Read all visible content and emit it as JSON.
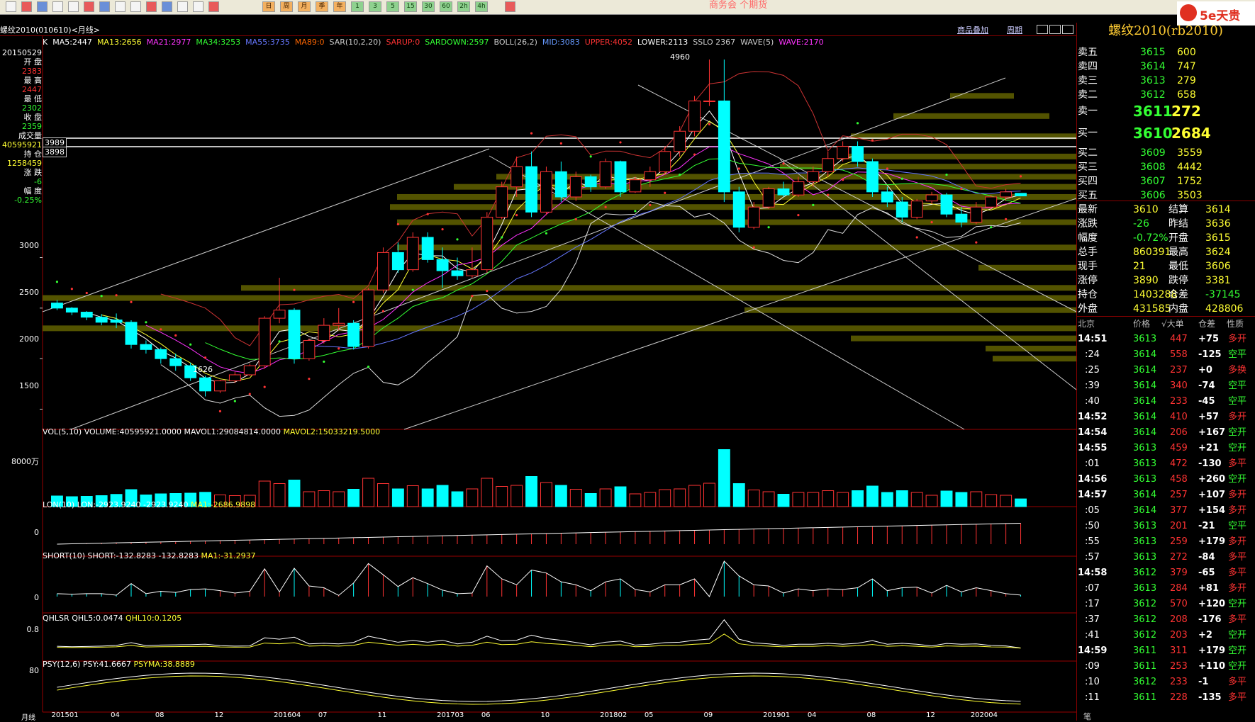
{
  "colors": {
    "up": "#ff3333",
    "down": "#00ffff",
    "bg": "#000000",
    "accent": "#ffcc33",
    "ma5": "#ffffff",
    "ma13": "#ffff33",
    "ma21": "#ff33ff",
    "ma34": "#33ff33",
    "ma55": "#6677ff",
    "ma89": "#ff6600"
  },
  "toolbar": {
    "menu_trail": "商务会 个期货",
    "logo_text": "5e天贵",
    "logo_icon": "logo-circle-icon",
    "period_buttons": [
      "日",
      "周",
      "月",
      "季",
      "年",
      "1",
      "3",
      "5",
      "15",
      "30",
      "60",
      "2h",
      "4h"
    ]
  },
  "titlebar": {
    "symbol": "螺纹2010(010610)<月线>",
    "right_tabs": [
      "商品叠加",
      "周期"
    ]
  },
  "indicators": {
    "k": "K",
    "ma5": "MA5:2447",
    "ma13": "MA13:2656",
    "ma21": "MA21:2977",
    "ma34": "MA34:3253",
    "ma55": "MA55:3735",
    "ma89": "MA89:0",
    "sar": "SAR(10,2,20)",
    "sarup": "SARUP:0",
    "sardown": "SARDOWN:2597",
    "boll": "BOLL(26,2)",
    "mid": "MID:3083",
    "upper": "UPPER:4052",
    "lower": "LOWER:2113",
    "sslo": "SSLO 2367",
    "wave": "WAVE(5)",
    "wave2": "WAVE:2170"
  },
  "left_info": {
    "date": "20150529",
    "open_l": "开 盘",
    "open": "2383",
    "high_l": "最 高",
    "high": "2447",
    "low_l": "最 低",
    "low": "2302",
    "close_l": "收 盘",
    "close": "2359",
    "vol_l": "成交量",
    "vol": "40595921",
    "oi_l": "持 仓",
    "oi": "1258459",
    "chg_l": "涨 跌",
    "chg": "-6",
    "pct_l": "幅 度",
    "pct": "-0.25%"
  },
  "price_axis": [
    "3989",
    "3898",
    "3000",
    "2500",
    "2000",
    "1500"
  ],
  "annot": {
    "hi": "4960",
    "lo": "1626"
  },
  "vol_panel": {
    "label": "VOL(5,10) VOLUME:40595921.0000",
    "mavol1": "MAVOL1:29084814.0000",
    "mavol2": "MAVOL2:15033219.5000",
    "axis": "8000万"
  },
  "lon_panel": {
    "label": "LON(10) LON:-2923.9240",
    "v": "-2923.9240",
    "ma": "MA1:-2686.9898",
    "axis": "0"
  },
  "short_panel": {
    "label": "SHORT(10) SHORT:-132.8283",
    "v": "-132.8283",
    "ma": "MA1:-31.2937",
    "axis": "0"
  },
  "qhlsr_panel": {
    "label": "QHLSR",
    "q5": "QHL5:0.0474",
    "q10": "QHL10:0.1205",
    "axis": "0.8"
  },
  "psy_panel": {
    "label": "PSY(12,6)",
    "psy": "PSY:41.6667",
    "psyma": "PSYMA:38.8889",
    "axis": "80"
  },
  "time_axis": {
    "head": "月线",
    "ticks": [
      "201501",
      "04",
      "08",
      "12",
      "201604",
      "07",
      "11",
      "201703",
      "06",
      "10",
      "201802",
      "05",
      "09",
      "201901",
      "04",
      "08",
      "12",
      "202004"
    ]
  },
  "right_panel": {
    "title": "螺纹2010(rb2010)",
    "asks": [
      {
        "l": "卖五",
        "p": "3615",
        "v": "600"
      },
      {
        "l": "卖四",
        "p": "3614",
        "v": "747"
      },
      {
        "l": "卖三",
        "p": "3613",
        "v": "279"
      },
      {
        "l": "卖二",
        "p": "3612",
        "v": "658"
      },
      {
        "l": "卖一",
        "p": "3611",
        "v": "272"
      }
    ],
    "bids": [
      {
        "l": "买一",
        "p": "3610",
        "v": "2684"
      },
      {
        "l": "买二",
        "p": "3609",
        "v": "3559"
      },
      {
        "l": "买三",
        "p": "3608",
        "v": "4442"
      },
      {
        "l": "买四",
        "p": "3607",
        "v": "1752"
      },
      {
        "l": "买五",
        "p": "3606",
        "v": "3503"
      }
    ],
    "stats": [
      {
        "a": "最新",
        "av": "3610",
        "b": "结算",
        "bv": "3614"
      },
      {
        "a": "涨跌",
        "av": "-26",
        "b": "昨结",
        "bv": "3636"
      },
      {
        "a": "幅度",
        "av": "-0.72%",
        "b": "开盘",
        "bv": "3615"
      },
      {
        "a": "总手",
        "av": "860391",
        "b": "最高",
        "bv": "3624"
      },
      {
        "a": "现手",
        "av": "21",
        "b": "最低",
        "bv": "3606"
      },
      {
        "a": "涨停",
        "av": "3890",
        "b": "跌停",
        "bv": "3381"
      },
      {
        "a": "持仓",
        "av": "1403288",
        "b": "仓差",
        "bv": "-37145"
      },
      {
        "a": "外盘",
        "av": "431585",
        "b": "内盘",
        "bv": "428806"
      }
    ],
    "tick_header": [
      "北京",
      "价格",
      "√大单",
      "仓差",
      "性质"
    ],
    "ticks": [
      {
        "t": "14:51",
        "p": "3613",
        "v": "447",
        "d": "+75",
        "n": "多开"
      },
      {
        "t": ":24",
        "p": "3614",
        "v": "558",
        "d": "-125",
        "n": "空平"
      },
      {
        "t": ":25",
        "p": "3614",
        "v": "237",
        "d": "+0",
        "n": "多换"
      },
      {
        "t": ":39",
        "p": "3614",
        "v": "340",
        "d": "-74",
        "n": "空平"
      },
      {
        "t": ":40",
        "p": "3614",
        "v": "233",
        "d": "-45",
        "n": "空平"
      },
      {
        "t": "14:52",
        "p": "3614",
        "v": "410",
        "d": "+57",
        "n": "多开"
      },
      {
        "t": "14:54",
        "p": "3614",
        "v": "206",
        "d": "+167",
        "n": "空开"
      },
      {
        "t": "14:55",
        "p": "3613",
        "v": "459",
        "d": "+21",
        "n": "空开"
      },
      {
        "t": ":01",
        "p": "3613",
        "v": "472",
        "d": "-130",
        "n": "多平"
      },
      {
        "t": "14:56",
        "p": "3613",
        "v": "458",
        "d": "+260",
        "n": "空开"
      },
      {
        "t": "14:57",
        "p": "3614",
        "v": "257",
        "d": "+107",
        "n": "多开"
      },
      {
        "t": ":05",
        "p": "3614",
        "v": "377",
        "d": "+154",
        "n": "多开"
      },
      {
        "t": ":50",
        "p": "3613",
        "v": "201",
        "d": "-21",
        "n": "空平"
      },
      {
        "t": ":55",
        "p": "3613",
        "v": "259",
        "d": "+179",
        "n": "多开"
      },
      {
        "t": ":57",
        "p": "3613",
        "v": "272",
        "d": "-84",
        "n": "多平"
      },
      {
        "t": "14:58",
        "p": "3612",
        "v": "379",
        "d": "-65",
        "n": "多平"
      },
      {
        "t": ":07",
        "p": "3613",
        "v": "284",
        "d": "+81",
        "n": "多开"
      },
      {
        "t": ":17",
        "p": "3612",
        "v": "570",
        "d": "+120",
        "n": "空开"
      },
      {
        "t": ":37",
        "p": "3612",
        "v": "208",
        "d": "-176",
        "n": "多平"
      },
      {
        "t": ":41",
        "p": "3612",
        "v": "203",
        "d": "+2",
        "n": "空开"
      },
      {
        "t": "14:59",
        "p": "3611",
        "v": "311",
        "d": "+179",
        "n": "空开"
      },
      {
        "t": ":09",
        "p": "3611",
        "v": "253",
        "d": "+110",
        "n": "空开"
      },
      {
        "t": ":10",
        "p": "3612",
        "v": "233",
        "d": "-1",
        "n": "多平"
      },
      {
        "t": ":11",
        "p": "3611",
        "v": "228",
        "d": "-135",
        "n": "多平"
      }
    ],
    "bottom_tab": "笔"
  },
  "chart_data": {
    "type": "candlestick",
    "categories": [
      "201501",
      "201502",
      "201503",
      "201504",
      "201505",
      "201506",
      "201507",
      "201508",
      "201509",
      "201510",
      "201511",
      "201512",
      "201601",
      "201602",
      "201603",
      "201604",
      "201605",
      "201606",
      "201607",
      "201608",
      "201609",
      "201610",
      "201611",
      "201612",
      "201701",
      "201702",
      "201703",
      "201704",
      "201705",
      "201706",
      "201707",
      "201708",
      "201709",
      "201710",
      "201711",
      "201712",
      "201801",
      "201802",
      "201803",
      "201804",
      "201805",
      "201806",
      "201807",
      "201808",
      "201809",
      "201810",
      "201811",
      "201812",
      "201901",
      "201902",
      "201903",
      "201904",
      "201905",
      "201906",
      "201907",
      "201908",
      "201909",
      "201910",
      "201911",
      "201912",
      "202001",
      "202002",
      "202003",
      "202004",
      "202005",
      "202006"
    ],
    "ohlc": [
      [
        2550,
        2580,
        2480,
        2500
      ],
      [
        2500,
        2510,
        2430,
        2460
      ],
      [
        2460,
        2470,
        2380,
        2410
      ],
      [
        2410,
        2440,
        2330,
        2360
      ],
      [
        2383,
        2447,
        2302,
        2359
      ],
      [
        2360,
        2380,
        2100,
        2140
      ],
      [
        2140,
        2180,
        2050,
        2090
      ],
      [
        2090,
        2110,
        1950,
        2000
      ],
      [
        2000,
        2050,
        1880,
        1930
      ],
      [
        1930,
        1960,
        1780,
        1810
      ],
      [
        1810,
        1830,
        1626,
        1680
      ],
      [
        1680,
        1790,
        1660,
        1780
      ],
      [
        1780,
        1870,
        1760,
        1840
      ],
      [
        1840,
        1950,
        1830,
        1930
      ],
      [
        1930,
        2420,
        1900,
        2400
      ],
      [
        2400,
        2800,
        2350,
        2480
      ],
      [
        2480,
        2500,
        1950,
        2000
      ],
      [
        2000,
        2200,
        1980,
        2180
      ],
      [
        2180,
        2400,
        2150,
        2330
      ],
      [
        2330,
        2500,
        2280,
        2350
      ],
      [
        2350,
        2380,
        2090,
        2120
      ],
      [
        2120,
        2700,
        2100,
        2680
      ],
      [
        2680,
        3100,
        2650,
        3050
      ],
      [
        3050,
        3150,
        2850,
        2880
      ],
      [
        2880,
        3250,
        2860,
        3200
      ],
      [
        3200,
        3250,
        2950,
        2980
      ],
      [
        2980,
        3100,
        2700,
        2870
      ],
      [
        2870,
        3000,
        2780,
        2820
      ],
      [
        2820,
        3100,
        2800,
        2880
      ],
      [
        2880,
        3450,
        2850,
        3400
      ],
      [
        3400,
        3750,
        3380,
        3700
      ],
      [
        3700,
        4000,
        3600,
        3900
      ],
      [
        3900,
        4050,
        3400,
        3450
      ],
      [
        3450,
        3900,
        3420,
        3850
      ],
      [
        3850,
        3950,
        3550,
        3600
      ],
      [
        3600,
        3850,
        3560,
        3800
      ],
      [
        3800,
        3820,
        3650,
        3700
      ],
      [
        3700,
        3980,
        3680,
        3950
      ],
      [
        3950,
        3960,
        3600,
        3650
      ],
      [
        3650,
        3800,
        3640,
        3770
      ],
      [
        3770,
        3900,
        3700,
        3850
      ],
      [
        3850,
        4100,
        3820,
        4050
      ],
      [
        4050,
        4300,
        4000,
        4250
      ],
      [
        4250,
        4600,
        4200,
        4550
      ],
      [
        4550,
        4960,
        4500,
        4550
      ],
      [
        4550,
        4960,
        3550,
        3650
      ],
      [
        3650,
        3700,
        3250,
        3300
      ],
      [
        3300,
        3550,
        3280,
        3500
      ],
      [
        3500,
        3700,
        3480,
        3680
      ],
      [
        3680,
        3750,
        3600,
        3620
      ],
      [
        3620,
        3800,
        3600,
        3750
      ],
      [
        3750,
        3900,
        3700,
        3850
      ],
      [
        3850,
        4050,
        3800,
        3980
      ],
      [
        3980,
        4150,
        3950,
        4100
      ],
      [
        4100,
        4150,
        3900,
        3950
      ],
      [
        3950,
        3980,
        3600,
        3650
      ],
      [
        3650,
        3700,
        3500,
        3550
      ],
      [
        3550,
        3600,
        3350,
        3400
      ],
      [
        3400,
        3580,
        3380,
        3560
      ],
      [
        3560,
        3650,
        3530,
        3620
      ],
      [
        3620,
        3640,
        3400,
        3430
      ],
      [
        3430,
        3500,
        3300,
        3350
      ],
      [
        3350,
        3550,
        3330,
        3500
      ],
      [
        3500,
        3620,
        3480,
        3600
      ],
      [
        3600,
        3680,
        3560,
        3650
      ],
      [
        3636,
        3624,
        3606,
        3610
      ]
    ],
    "ylim": [
      1300,
      5100
    ]
  }
}
